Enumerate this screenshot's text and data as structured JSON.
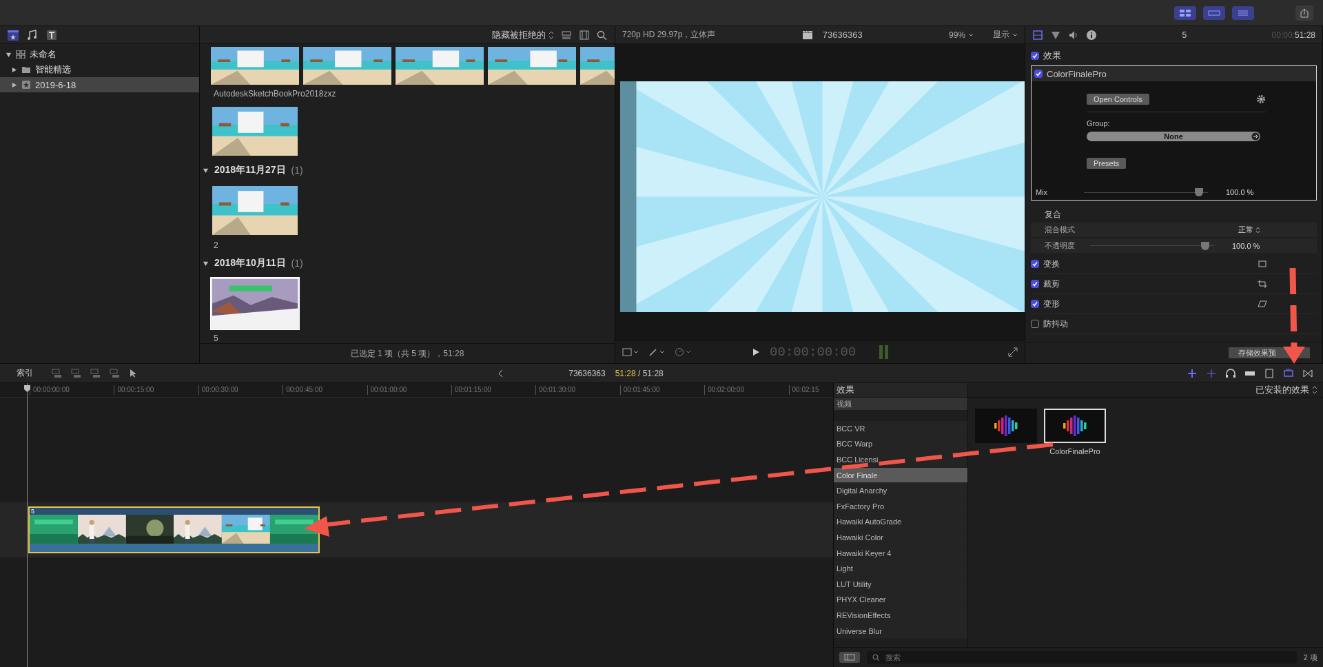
{
  "workspace_buttons": [
    {
      "kind": "library",
      "on": true
    },
    {
      "kind": "timeline",
      "on": true
    },
    {
      "kind": "inspector",
      "on": true
    }
  ],
  "library": {
    "name": "未命名",
    "expanded": true,
    "children": [
      {
        "name": "智能精选",
        "expanded": false,
        "selected": false
      },
      {
        "name": "2019-6-18",
        "expanded": false,
        "selected": true
      }
    ]
  },
  "browser": {
    "filter": "隐藏被拒绝的",
    "groups": [
      {
        "clips": [
          {
            "name": "AutodeskSketchBookPro2018zxz",
            "selected": false
          },
          {
            "selected": false
          }
        ]
      },
      {
        "title": "2018年11月27日",
        "count": "(1)",
        "expanded": true,
        "clips": [
          {
            "name": "2",
            "selected": false
          }
        ]
      },
      {
        "title": "2018年10月11日",
        "count": "(1)",
        "expanded": true,
        "clips": [
          {
            "name": "5",
            "selected": true
          }
        ]
      }
    ],
    "status": "已选定 1 项（共 5 项），51:28"
  },
  "viewer": {
    "format": "720p HD 29.97p，立体声",
    "project": "73636363",
    "zoom": "99%",
    "view_menu": "显示",
    "timecode": "00:00:00:00"
  },
  "inspector": {
    "tabs": [
      {
        "kind": "video",
        "selected": true
      },
      {
        "kind": "color",
        "selected": false
      },
      {
        "kind": "audio",
        "selected": false
      },
      {
        "kind": "info",
        "selected": false
      }
    ],
    "clip_name": "5",
    "timecode_dim": "00:00:",
    "timecode": "51:28",
    "effects_header": {
      "label": "效果",
      "checked": true
    },
    "effect": {
      "name": "ColorFinalePro",
      "checked": true,
      "open_button": "Open Controls",
      "group_label": "Group:",
      "group_value": "None",
      "presets_button": "Presets",
      "mix": {
        "label": "Mix",
        "level": 0.93,
        "reading": "100.0 %"
      }
    },
    "compositing": {
      "title": "复合",
      "blend": {
        "label": "混合模式",
        "value": "正常"
      },
      "opacity": {
        "label": "不透明度",
        "level": 0.93,
        "reading": "100.0 %"
      }
    },
    "sections": [
      {
        "label": "变换",
        "checked": true,
        "kind": "transform"
      },
      {
        "label": "裁剪",
        "checked": true,
        "kind": "crop"
      },
      {
        "label": "变形",
        "checked": true,
        "kind": "distort"
      },
      {
        "label": "防抖动",
        "checked": false,
        "kind": "plain"
      }
    ],
    "save_button": "存储效果预"
  },
  "timeline_bar": {
    "index_button": "索引",
    "project": "73636363",
    "time_current": "51:28",
    "time_total": "/ 51:28"
  },
  "timeline": {
    "ticks": [
      "00:00:00:00",
      "00:00:15:00",
      "00:00:30:00",
      "00:00:45:00",
      "00:01:00:00",
      "00:01:15:00",
      "00:01:30:00",
      "00:01:45:00",
      "00:02:00:00",
      "00:02:15"
    ],
    "clip": {
      "label": "5",
      "selected": true
    }
  },
  "effects_browser": {
    "title": "效果",
    "filter": "已安装的效果",
    "category_header": "视频",
    "categories": [
      {
        "label": "BCC VR",
        "selected": false
      },
      {
        "label": "BCC Warp",
        "selected": false
      },
      {
        "label": "BCC Licensi",
        "selected": false
      },
      {
        "label": "Color Finale",
        "selected": true
      },
      {
        "label": "Digital Anarchy",
        "selected": false
      },
      {
        "label": "FxFactory Pro",
        "selected": false
      },
      {
        "label": "Hawaiki AutoGrade",
        "selected": false
      },
      {
        "label": "Hawaiki Color",
        "selected": false
      },
      {
        "label": "Hawaiki Keyer 4",
        "selected": false
      },
      {
        "label": "Light",
        "selected": false
      },
      {
        "label": "LUT Utility",
        "selected": false
      },
      {
        "label": "PHYX Cleaner",
        "selected": false
      },
      {
        "label": "REVisionEffects",
        "selected": false
      },
      {
        "label": "Universe Blur",
        "selected": false
      }
    ],
    "effects": [
      {
        "selected": false
      },
      {
        "name": "ColorFinalePro",
        "selected": true
      }
    ],
    "search": {
      "placeholder": "搜索"
    },
    "count": "2 项"
  }
}
